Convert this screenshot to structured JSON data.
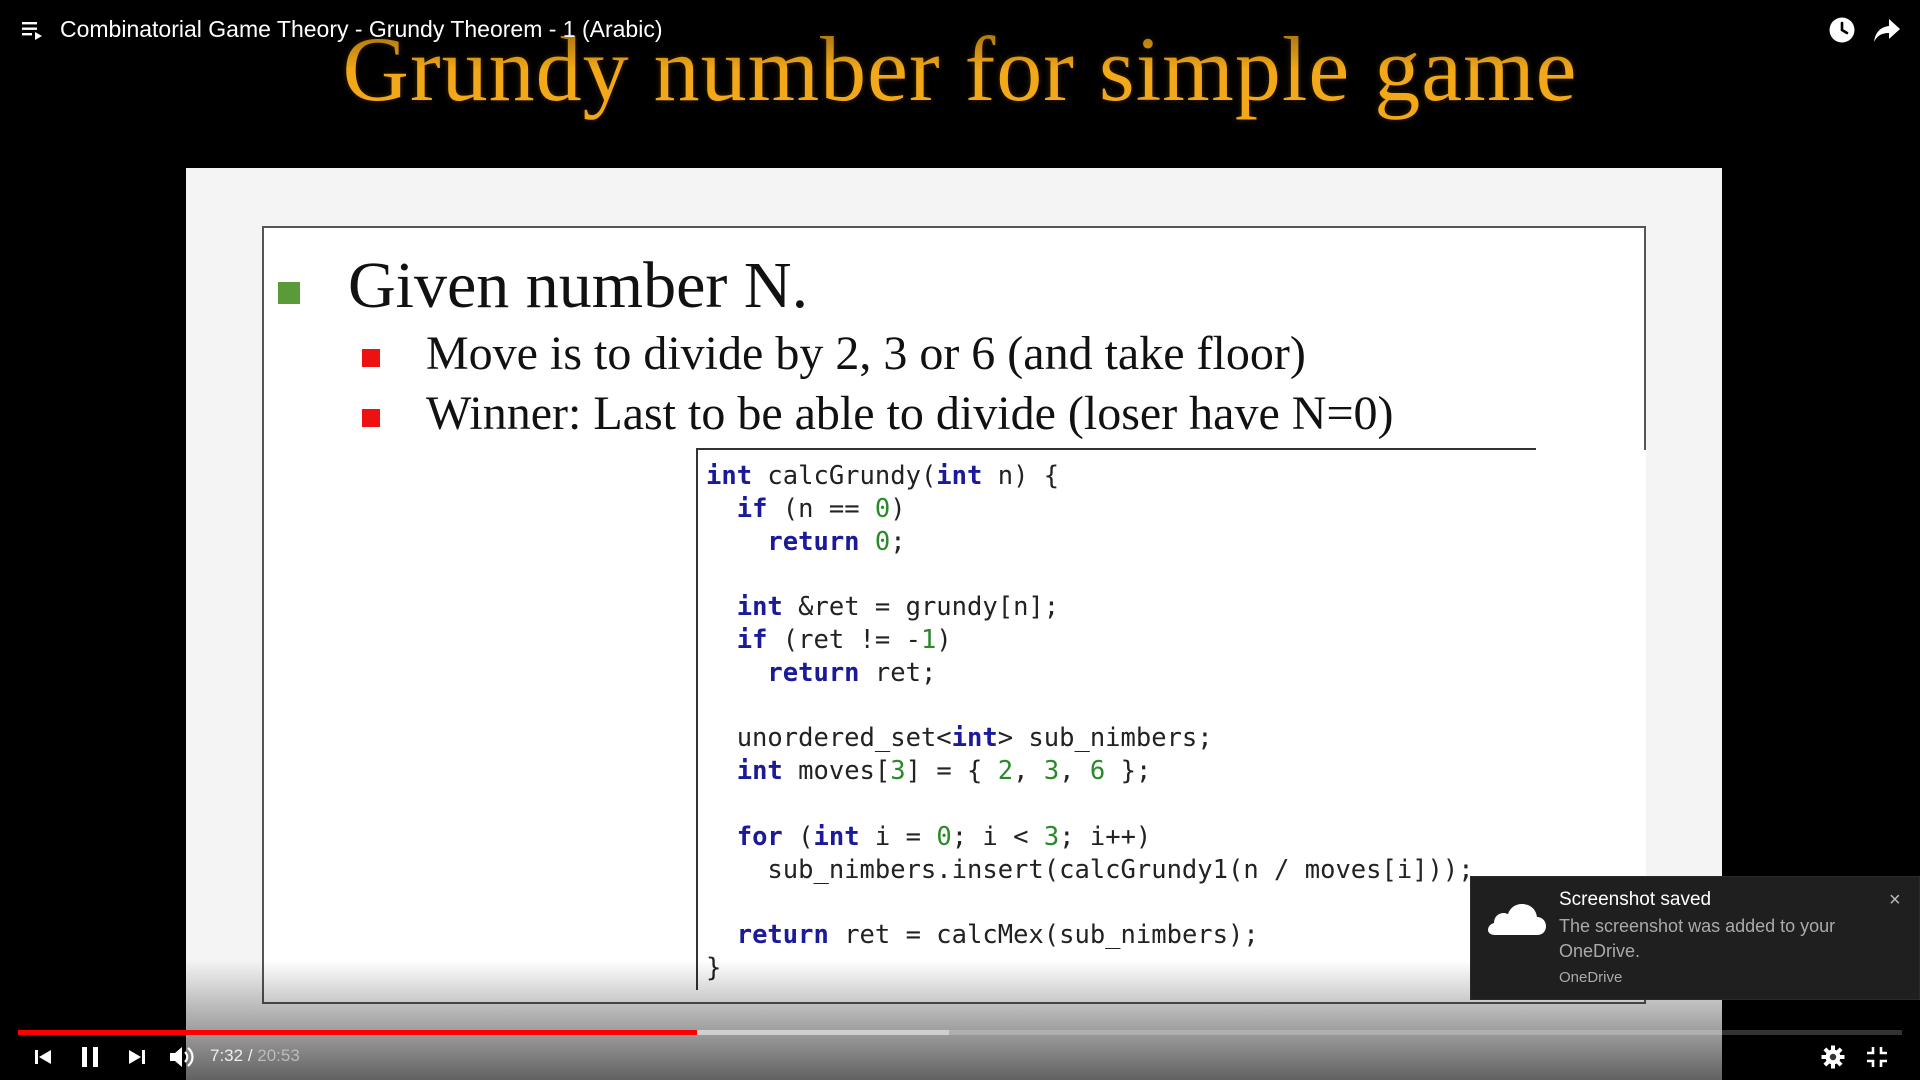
{
  "player": {
    "title": "Combinatorial Game Theory - Grundy Theorem - 1 (Arabic)",
    "time_current": "7:32",
    "time_separator": " / ",
    "time_total": "20:53",
    "progress_played": 0.3604,
    "progress_buffered": 0.4941,
    "icons": {
      "playlist": "playlist-icon",
      "watch_later": "clock-icon",
      "share": "share-icon",
      "prev": "skip-previous-icon",
      "pause": "pause-icon",
      "next": "skip-next-icon",
      "volume": "volume-icon",
      "settings": "gear-icon",
      "exit_fullscreen": "exit-fullscreen-icon"
    },
    "colors": {
      "progress": "#ff0000"
    }
  },
  "slide": {
    "heading": "Grundy number for simple game",
    "bullet_main": "Given number N.",
    "bullets_sub": [
      "Move is to divide by 2, 3 or 6 (and take floor)",
      "Winner: Last to be able to divide (loser have N=0)"
    ],
    "code_lines": [
      "int calcGrundy(int n) {",
      "  if (n == 0)",
      "    return 0;",
      "",
      "  int &ret = grundy[n];",
      "  if (ret != -1)",
      "    return ret;",
      "",
      "  unordered_set<int> sub_nimbers;",
      "  int moves[3] = { 2, 3, 6 };",
      "",
      "  for (int i = 0; i < 3; i++)",
      "    sub_nimbers.insert(calcGrundy1(n / moves[i]));",
      "",
      "  return ret = calcMex(sub_nimbers);",
      "}"
    ],
    "colors": {
      "heading": "#f2a818",
      "main_bullet": "#5a9a3a",
      "sub_bullet": "#ee1111"
    }
  },
  "toast": {
    "title": "Screenshot saved",
    "body": "The screenshot was added to your OneDrive.",
    "app": "OneDrive",
    "close": "×",
    "icon": "cloud-icon"
  }
}
